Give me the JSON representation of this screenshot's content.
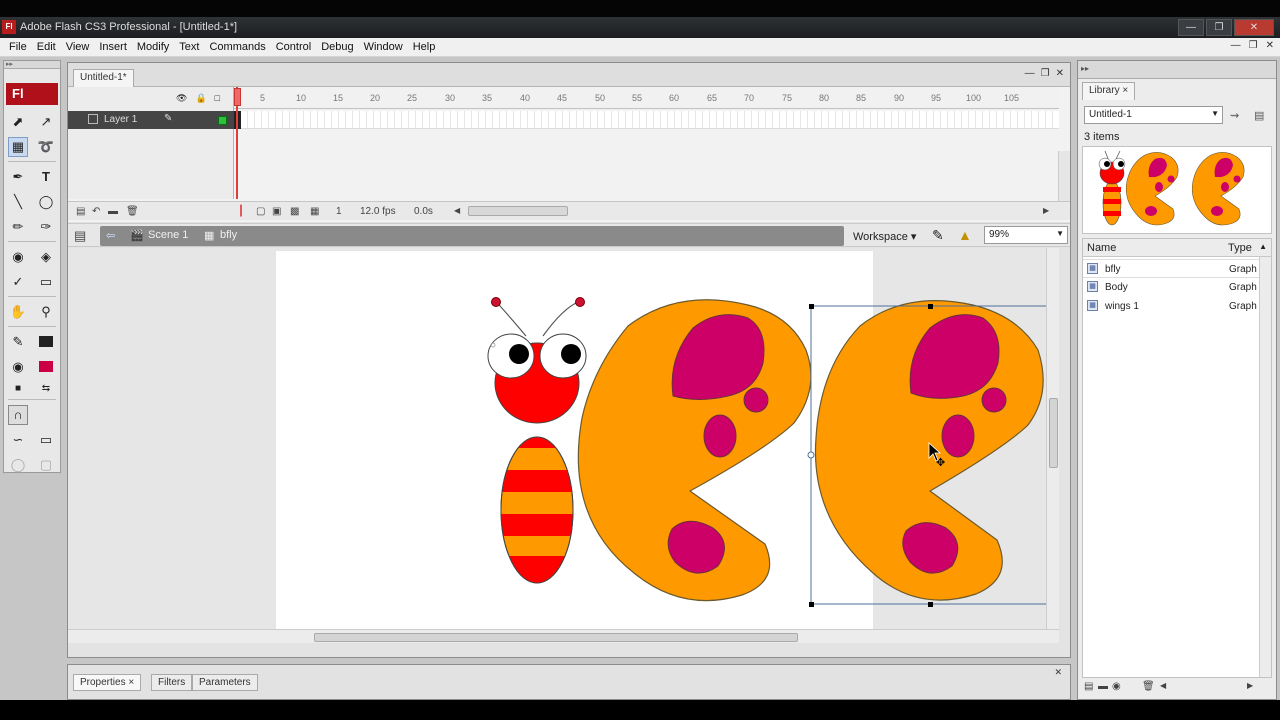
{
  "window": {
    "title": "Adobe Flash CS3 Professional - [Untitled-1*]",
    "app_icon": "Fl"
  },
  "menu": [
    "File",
    "Edit",
    "View",
    "Insert",
    "Modify",
    "Text",
    "Commands",
    "Control",
    "Debug",
    "Window",
    "Help"
  ],
  "tools": {
    "logo": "Fl"
  },
  "document": {
    "tab": "Untitled-1*",
    "ruler_ticks": [
      "5",
      "10",
      "15",
      "20",
      "25",
      "30",
      "35",
      "40",
      "45",
      "50",
      "55",
      "60",
      "65",
      "70",
      "75",
      "80",
      "85",
      "90",
      "95",
      "100",
      "105"
    ],
    "layer_name": "Layer 1",
    "current_frame": "1",
    "fps": "12.0 fps",
    "elapsed": "0.0s",
    "scene": "Scene 1",
    "symbol": "bfly",
    "workspace_label": "Workspace",
    "zoom": "99%"
  },
  "properties_panel": {
    "tabs": [
      "Properties",
      "Filters",
      "Parameters"
    ]
  },
  "library": {
    "tab": "Library",
    "document": "Untitled-1",
    "item_count": "3 items",
    "columns": {
      "name": "Name",
      "type": "Type"
    },
    "items": [
      {
        "name": "bfly",
        "type": "Graph"
      },
      {
        "name": "Body",
        "type": "Graph"
      },
      {
        "name": "wings 1",
        "type": "Graph"
      }
    ]
  },
  "colors": {
    "wing": "#ff9900",
    "spot": "#cc0066",
    "body_red": "#ff0000",
    "stroke_swatch": "#222222",
    "fill_swatch": "#cc0044"
  }
}
